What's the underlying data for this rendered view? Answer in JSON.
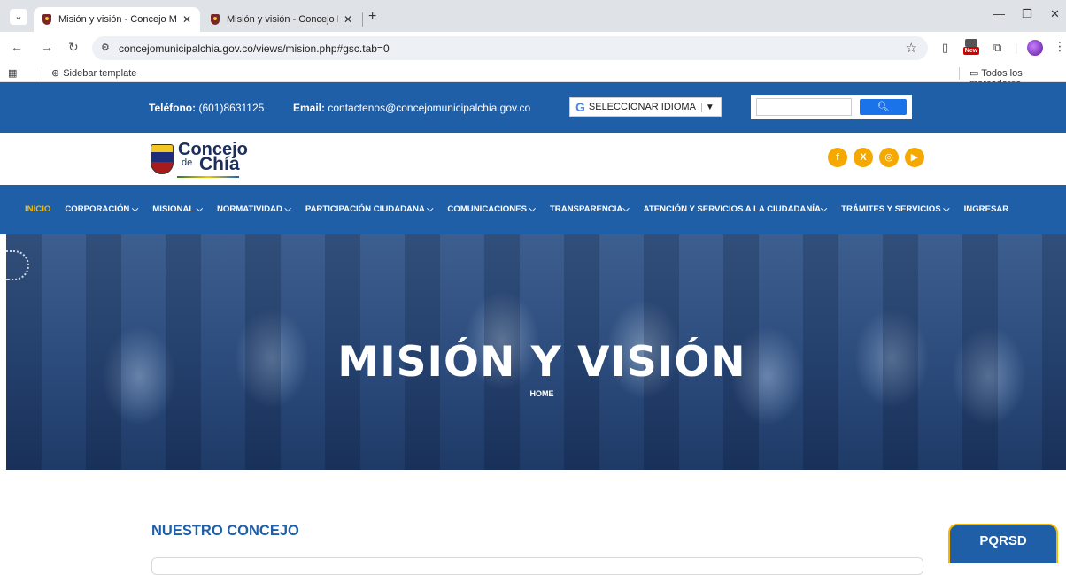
{
  "browser": {
    "tabs": [
      {
        "title": "Misión y visión - Concejo Munic",
        "active": true
      },
      {
        "title": "Misión y visión - Concejo Munic",
        "active": false
      }
    ],
    "url": "concejomunicipalchia.gov.co/views/mision.php#gsc.tab=0",
    "bookmarks": {
      "item": "Sidebar template",
      "all": "Todos los marcadores"
    },
    "ext_new_label": "New"
  },
  "topbar": {
    "phone_label": "Teléfono:",
    "phone": "(601)8631125",
    "email_label": "Email:",
    "email": "contactenos@concejomunicipalchia.gov.co",
    "translate": "SELECCIONAR IDIOMA",
    "search_placeholder": ""
  },
  "logo": {
    "line1": "Concejo",
    "line2_small": "de",
    "line2": "Chía"
  },
  "socials": [
    "facebook-icon",
    "x-icon",
    "instagram-icon",
    "youtube-icon"
  ],
  "nav": [
    "INICIO",
    "CORPORACIÓN ⌵",
    "MISIONAL ⌵",
    "NORMATIVIDAD ⌵",
    "PARTICIPACIÓN CIUDADANA ⌵",
    "COMUNICACIONES ⌵",
    "TRANSPARENCIA⌵",
    "ATENCIÓN Y SERVICIOS A LA CIUDADANÍA⌵",
    "TRÁMITES Y SERVICIOS ⌵",
    "INGRESAR"
  ],
  "hero": {
    "title": "MISIÓN Y VISIÓN",
    "breadcrumb": "HOME"
  },
  "section": {
    "title": "NUESTRO CONCEJO"
  },
  "pqrsd": "PQRSD",
  "colors": {
    "brand_blue": "#1f5fa8",
    "accent_yellow": "#f5b700"
  }
}
